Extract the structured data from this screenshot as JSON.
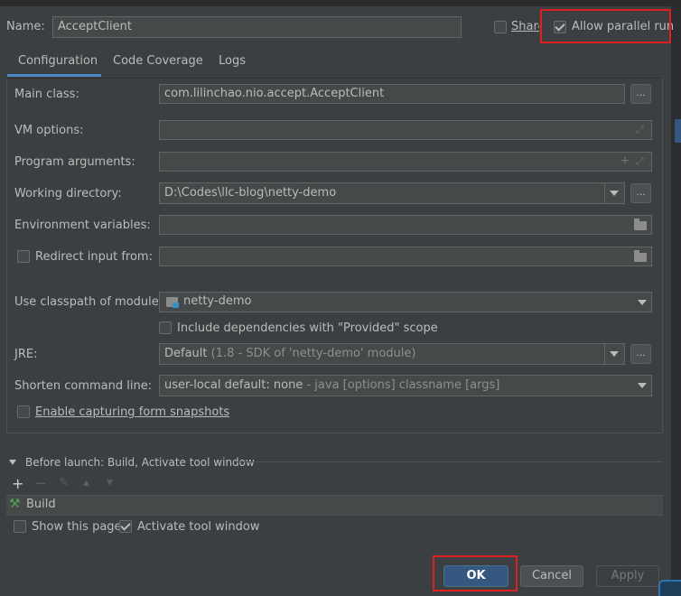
{
  "header": {
    "name_label": "Name:",
    "name_value": "AcceptClient",
    "share_label": "Share",
    "allow_parallel_label": "Allow parallel run"
  },
  "tabs": [
    {
      "label": "Configuration"
    },
    {
      "label": "Code Coverage"
    },
    {
      "label": "Logs"
    }
  ],
  "form": {
    "main_class_label": "Main class:",
    "main_class_value": "com.lilinchao.nio.accept.AcceptClient",
    "vm_options_label": "VM options:",
    "program_args_label": "Program arguments:",
    "working_dir_label": "Working directory:",
    "working_dir_value": "D:\\Codes\\llc-blog\\netty-demo",
    "env_vars_label": "Environment variables:",
    "redirect_label": "Redirect input from:",
    "classpath_label": "Use classpath of module:",
    "classpath_value": "netty-demo",
    "include_deps_label": "Include dependencies with \"Provided\" scope",
    "jre_label": "JRE:",
    "jre_value_main": "Default",
    "jre_value_detail": "(1.8 - SDK of 'netty-demo' module)",
    "shorten_label": "Shorten command line:",
    "shorten_value_main": "user-local default: none",
    "shorten_value_detail": "- java [options] classname [args]",
    "enable_capture_label": "Enable capturing form snapshots",
    "ellipsis": "...",
    "plus": "+"
  },
  "before_launch": {
    "title": "Before launch: Build, Activate tool window",
    "toolbar": {
      "add": "+",
      "remove": "−",
      "up": "▲",
      "down": "▼"
    },
    "item": "Build",
    "show_page_label": "Show this page",
    "activate_label": "Activate tool window"
  },
  "buttons": {
    "ok": "OK",
    "cancel": "Cancel",
    "apply": "Apply"
  },
  "colors": {
    "background": "#3c3f41",
    "field": "#45494a",
    "ok_button": "#365880",
    "tab_underline": "#4a88c7",
    "highlight": "#e02020"
  }
}
